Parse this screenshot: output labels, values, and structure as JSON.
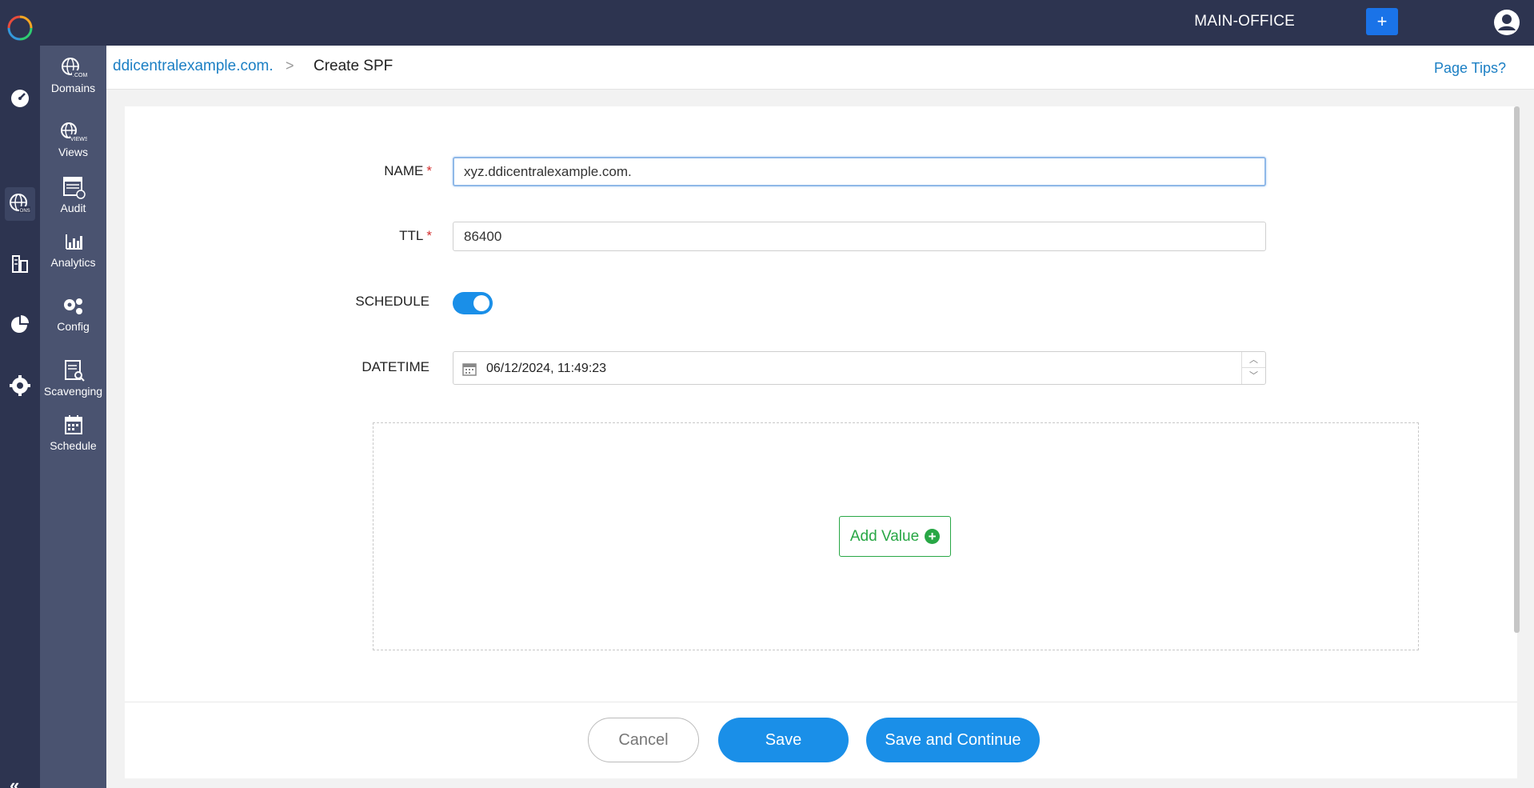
{
  "topbar": {
    "office": "MAIN-OFFICE",
    "add_label": "+"
  },
  "subnav": {
    "items": [
      {
        "label": "Domains",
        "icon": "domains-globe-icon"
      },
      {
        "label": "Views",
        "icon": "views-globe-icon"
      },
      {
        "label": "Audit",
        "icon": "audit-icon"
      },
      {
        "label": "Analytics",
        "icon": "analytics-icon"
      },
      {
        "label": "Config",
        "icon": "config-gears-icon"
      },
      {
        "label": "Scavenging",
        "icon": "scavenging-icon"
      },
      {
        "label": "Schedule",
        "icon": "schedule-calendar-icon"
      }
    ]
  },
  "header": {
    "breadcrumb_link": "ddicentralexample.com.",
    "breadcrumb_sep": ">",
    "breadcrumb_current": "Create SPF",
    "page_tips": "Page Tips?"
  },
  "form": {
    "name_label": "NAME",
    "name_value": "xyz.ddicentralexample.com.",
    "ttl_label": "TTL",
    "ttl_value": "86400",
    "schedule_label": "SCHEDULE",
    "schedule_on": true,
    "datetime_label": "DATETIME",
    "datetime_value": "06/12/2024, 11:49:23",
    "required_mark": "*",
    "add_value_label": "Add Value"
  },
  "footer": {
    "cancel_label": "Cancel",
    "save_label": "Save",
    "save_continue_label": "Save and Continue"
  },
  "colors": {
    "topbar_bg": "#2d3450",
    "subnav_bg": "#4a5370",
    "accent_blue": "#1a8fe8",
    "link_blue": "#1b7fc4",
    "success_green": "#28a745",
    "required_red": "#d32f2f"
  }
}
